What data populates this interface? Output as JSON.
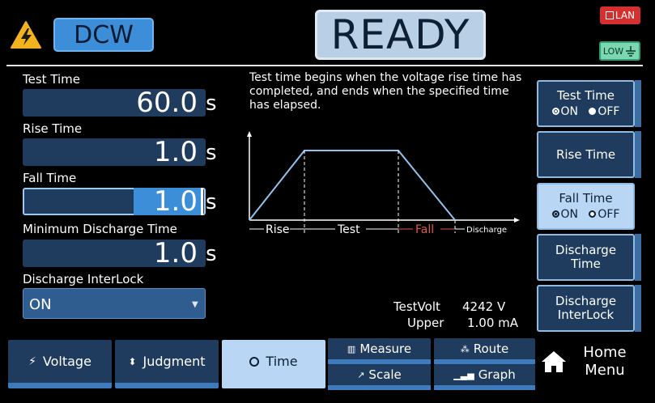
{
  "header": {
    "mode": "DCW",
    "status": "READY",
    "lan_label": "LAN",
    "low_label": "LOW"
  },
  "fields": {
    "test_time": {
      "label": "Test Time",
      "value": "60.0",
      "unit": "s"
    },
    "rise_time": {
      "label": "Rise Time",
      "value": "1.0",
      "unit": "s"
    },
    "fall_time": {
      "label": "Fall Time",
      "value": "1.0",
      "unit": "s"
    },
    "min_discharge": {
      "label": "Minimum Discharge Time",
      "value": "1.0",
      "unit": "s"
    },
    "discharge_interlock": {
      "label": "Discharge InterLock",
      "value": "ON"
    }
  },
  "info": {
    "description": "Test time begins when the voltage rise time has completed, and ends when the specified time has elapsed.",
    "diagram": {
      "rise": "Rise",
      "test": "Test",
      "fall": "Fall",
      "discharge": "Discharge"
    }
  },
  "readouts": {
    "testvolt_label": "TestVolt",
    "testvolt_value": "4242 V",
    "upper_label": "Upper",
    "upper_value": "1.00 mA"
  },
  "right_buttons": {
    "test_time": {
      "label": "Test Time",
      "on": "ON",
      "off": "OFF"
    },
    "rise_time": {
      "label": "Rise Time"
    },
    "fall_time": {
      "label": "Fall Time",
      "on": "ON",
      "off": "OFF"
    },
    "discharge_time": {
      "label1": "Discharge",
      "label2": "Time"
    },
    "discharge_interlock": {
      "label1": "Discharge",
      "label2": "InterLock"
    }
  },
  "tabs": {
    "voltage": "Voltage",
    "judgment": "Judgment",
    "time": "Time",
    "measure": "Measure",
    "scale": "Scale",
    "route": "Route",
    "graph": "Graph",
    "home1": "Home",
    "home2": "Menu"
  },
  "colors": {
    "accent": "#3d8ed8",
    "panel": "#1f3b5e",
    "fall_label": "#e05a4a",
    "lan": "#d43030",
    "low": "#7ad7b0"
  }
}
